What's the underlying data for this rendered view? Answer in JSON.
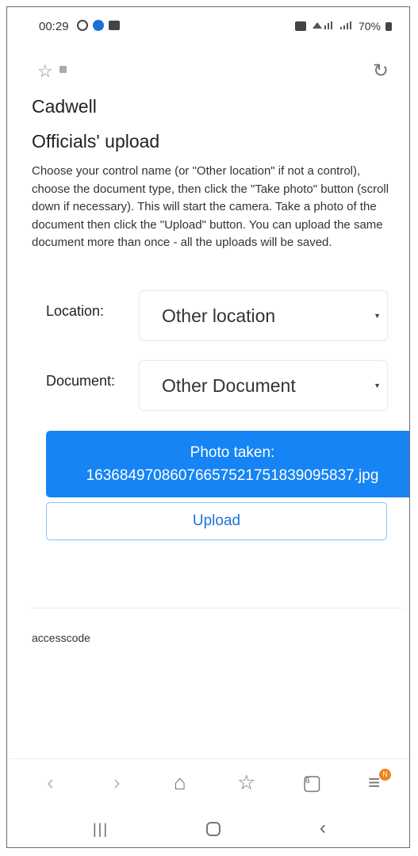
{
  "status_bar": {
    "time": "00:29",
    "battery": "70%"
  },
  "browser": {
    "bookmark_icon": "star-outline-icon",
    "lock_icon": "lock-icon",
    "reload_icon": "reload-icon"
  },
  "page": {
    "site_title": "Cadwell",
    "heading": "Officials' upload",
    "instructions": "Choose your control name (or \"Other location\" if not a control), choose the document type, then click the \"Take photo\" button (scroll down if necessary). This will start the camera. Take a photo of the document then click the \"Upload\" button. You can upload the same document more than once - all the uploads will be saved.",
    "location": {
      "label": "Location:",
      "value": "Other location"
    },
    "document": {
      "label": "Document:",
      "value": "Other Document"
    },
    "photo_button": {
      "line1": "Photo taken:",
      "line2": "16368497086076657521751839095837.jpg"
    },
    "upload_button": "Upload",
    "footer_text": "accesscode"
  },
  "bottom_nav": {
    "tabs_count": "6",
    "menu_badge": "N"
  },
  "colors": {
    "primary": "#1684f4",
    "badge": "#f08418"
  }
}
